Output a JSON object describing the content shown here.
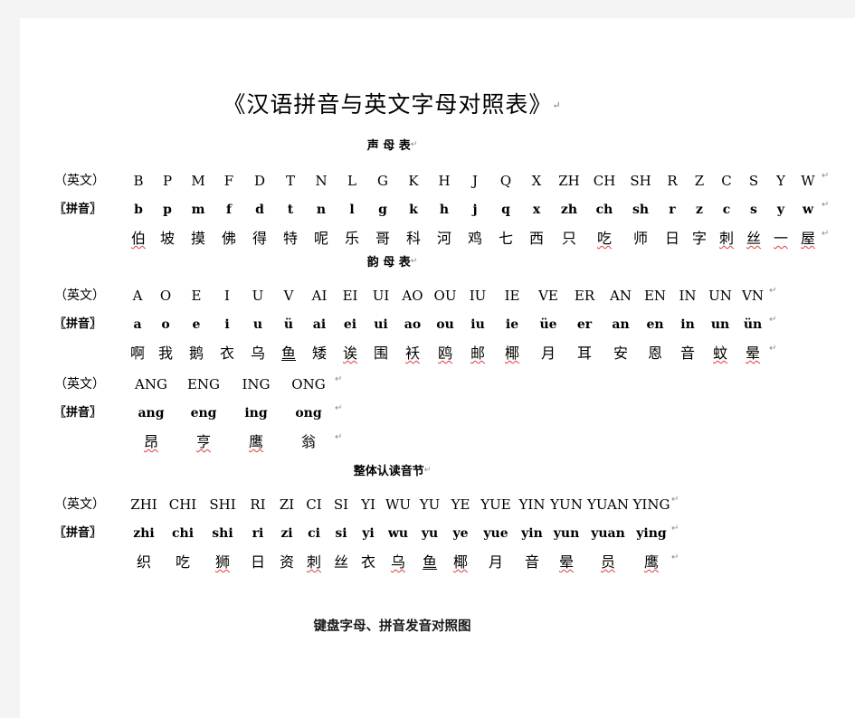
{
  "document": {
    "title": "《汉语拼音与英文字母对照表》",
    "bottom_heading": "键盘字母、拼音发音对照图",
    "cr_mark": "↵"
  },
  "labels": {
    "english": "（英文）",
    "pinyin": "〖拼音〗"
  },
  "sections": [
    {
      "id": "shengmu",
      "heading": "声  母  表",
      "english": [
        "B",
        "P",
        "M",
        "F",
        "D",
        "T",
        "N",
        "L",
        "G",
        "K",
        "H",
        "J",
        "Q",
        "X",
        "ZH",
        "CH",
        "SH",
        "R",
        "Z",
        "C",
        "S",
        "Y",
        "W"
      ],
      "pinyin": [
        "b",
        "p",
        "m",
        "f",
        "d",
        "t",
        "n",
        "l",
        "g",
        "k",
        "h",
        "j",
        "q",
        "x",
        "zh",
        "ch",
        "sh",
        "r",
        "z",
        "c",
        "s",
        "y",
        "w"
      ],
      "hanzi": [
        "伯",
        "坡",
        "摸",
        "佛",
        "得",
        "特",
        "呢",
        "乐",
        "哥",
        "科",
        "河",
        "鸡",
        "七",
        "西",
        "只",
        "吃",
        "师",
        "日",
        "字",
        "刺",
        "丝",
        "一",
        "屋"
      ],
      "hanzi_marks": [
        "wavy",
        "",
        "",
        "",
        "",
        "",
        "",
        "",
        "",
        "",
        "",
        "",
        "",
        "",
        "",
        "wavy",
        "",
        "",
        "",
        "wavy",
        "wavy",
        "wavy",
        "wavy"
      ]
    },
    {
      "id": "yunmu",
      "heading": "韵  母  表",
      "english": [
        "A",
        "O",
        "E",
        "I",
        "U",
        "V",
        "AI",
        "EI",
        "UI",
        "AO",
        "OU",
        "IU",
        "IE",
        "VE",
        "ER",
        "AN",
        "EN",
        "IN",
        "UN",
        "VN"
      ],
      "pinyin": [
        "a",
        "o",
        "e",
        "i",
        "u",
        "ü",
        "ai",
        "ei",
        "ui",
        "ao",
        "ou",
        "iu",
        "ie",
        "üe",
        "er",
        "an",
        "en",
        "in",
        "un",
        "ün"
      ],
      "hanzi": [
        "啊",
        "我",
        "鹅",
        "衣",
        "乌",
        "鱼",
        "矮",
        "诶",
        "围",
        "袄",
        "鸥",
        "邮",
        "椰",
        "月",
        "耳",
        "安",
        "恩",
        "音",
        "蚊",
        "晕"
      ],
      "hanzi_marks": [
        "",
        "",
        "",
        "",
        "",
        "straight",
        "",
        "wavy",
        "",
        "wavy",
        "wavy",
        "wavy",
        "wavy",
        "",
        "",
        "",
        "",
        "",
        "wavy",
        "wavy"
      ]
    },
    {
      "id": "yunmu2",
      "heading": "",
      "english": [
        "ANG",
        "ENG",
        "ING",
        "ONG"
      ],
      "pinyin": [
        "ang",
        "eng",
        "ing",
        "ong"
      ],
      "hanzi": [
        "昂",
        "亨",
        "鹰",
        "翁"
      ],
      "hanzi_marks": [
        "wavy",
        "wavy",
        "wavy",
        ""
      ]
    },
    {
      "id": "zhengti",
      "heading": "整体认读音节",
      "english": [
        "ZHI",
        "CHI",
        "SHI",
        "RI",
        "ZI",
        "CI",
        "SI",
        "YI",
        "WU",
        "YU",
        "YE",
        "YUE",
        "YIN",
        "YUN",
        "YUAN",
        "YING"
      ],
      "pinyin": [
        "zhi",
        "chi",
        "shi",
        "ri",
        "zi",
        "ci",
        "si",
        "yi",
        "wu",
        "yu",
        "ye",
        "yue",
        "yin",
        "yun",
        "yuan",
        "ying"
      ],
      "hanzi": [
        "织",
        "吃",
        "狮",
        "日",
        "资",
        "刺",
        "丝",
        "衣",
        "乌",
        "鱼",
        "椰",
        "月",
        "音",
        "晕",
        "员",
        "鹰"
      ],
      "hanzi_marks": [
        "",
        "",
        "wavy",
        "",
        "",
        "wavy",
        "",
        "",
        "wavy",
        "straight",
        "wavy",
        "",
        "",
        "wavy",
        "wavy",
        "wavy"
      ]
    }
  ]
}
